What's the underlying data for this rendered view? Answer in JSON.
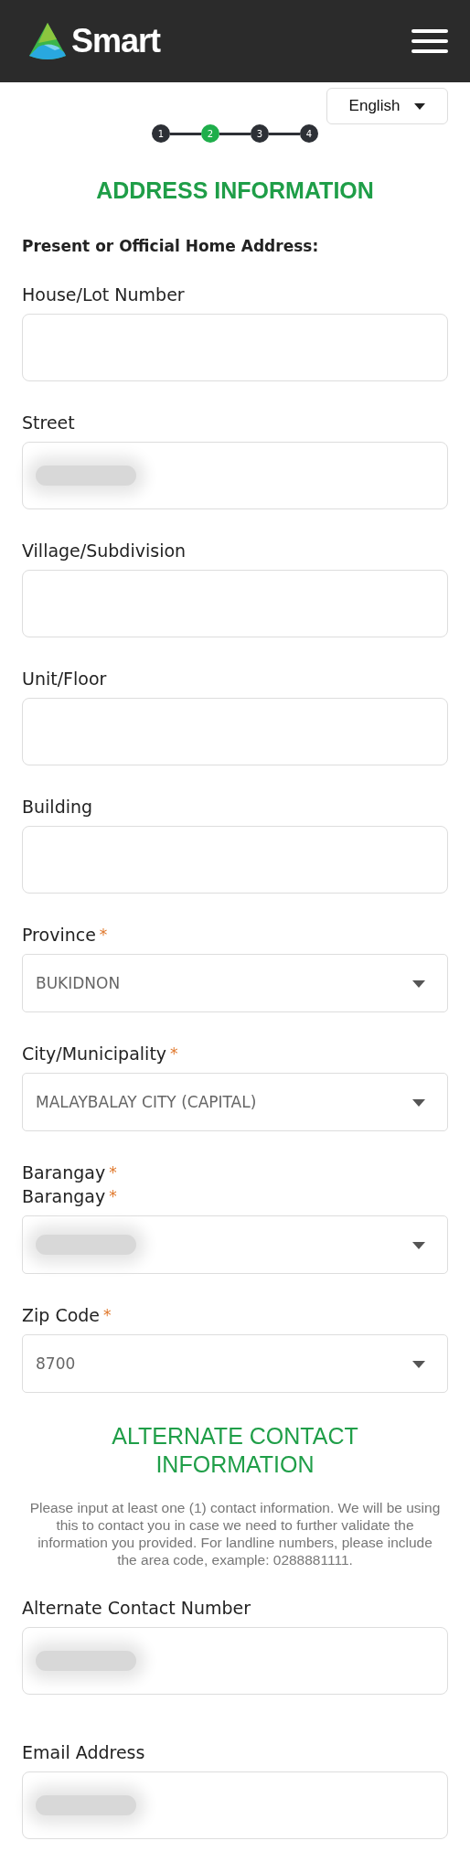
{
  "header": {
    "brand": "Smart"
  },
  "language": {
    "label": "English"
  },
  "stepper": [
    {
      "label": "1",
      "selected": false
    },
    {
      "label": "2",
      "selected": true
    },
    {
      "label": "3",
      "selected": false
    },
    {
      "label": "4",
      "selected": false
    }
  ],
  "title": "ADDRESS INFORMATION",
  "section_label": "Present or Official Home Address:",
  "fields": [
    {
      "kind": "text",
      "labels": [
        "House/Lot Number"
      ]
    },
    {
      "kind": "text",
      "labels": [
        "Street"
      ],
      "redacted": true
    },
    {
      "kind": "text",
      "labels": [
        "Village/Subdivision"
      ]
    },
    {
      "kind": "text",
      "labels": [
        "Unit/Floor"
      ]
    },
    {
      "kind": "text",
      "labels": [
        "Building"
      ]
    },
    {
      "kind": "select",
      "labels": [
        "Province"
      ],
      "required_mark": "*",
      "value": "BUKIDNON"
    },
    {
      "kind": "select",
      "labels": [
        "City/Municipality"
      ],
      "required_mark": "*",
      "value": "MALAYBALAY CITY (CAPITAL)"
    },
    {
      "kind": "select",
      "labels": [
        "Barangay",
        "Barangay"
      ],
      "required_mark": "*",
      "redacted": true
    },
    {
      "kind": "select",
      "labels": [
        "Zip Code"
      ],
      "required_mark": "*",
      "value": "8700"
    }
  ],
  "alternate": {
    "title": "ALTERNATE CONTACT INFORMATION",
    "note": "Please input at least one (1) contact information. We will be using this to contact you in case we need to further validate the information you provided. For landline numbers, please include the area code, example: 0288881111.",
    "fields": [
      {
        "kind": "text",
        "labels": [
          "Alternate Contact Number"
        ],
        "redacted": true
      },
      {
        "kind": "text",
        "labels": [
          "Email Address"
        ],
        "redacted": true
      }
    ]
  }
}
